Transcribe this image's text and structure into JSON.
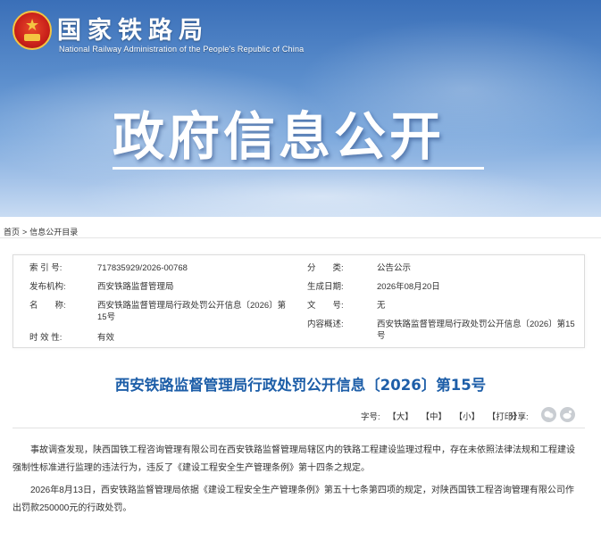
{
  "header": {
    "site_title": "国家铁路局",
    "site_subtitle": "National Railway Administration of the People's Republic of China",
    "banner_title": "政府信息公开"
  },
  "breadcrumb": {
    "home": "首页",
    "separator": ">",
    "current": "信息公开目录"
  },
  "info": {
    "index_label": "索 引 号:",
    "index_value": "717835929/2026-00768",
    "category_label": "分　　类:",
    "category_value": "公告公示",
    "publisher_label": "发布机构:",
    "publisher_value": "西安铁路监督管理局",
    "date_label": "生成日期:",
    "date_value": "2026年08月20日",
    "name_label": "名　　称:",
    "name_value": "西安铁路监督管理局行政处罚公开信息〔2026〕第15号",
    "docno_label": "文　　号:",
    "docno_value": "无",
    "summary_label": "内容概述:",
    "summary_value": "西安铁路监督管理局行政处罚公开信息〔2026〕第15号",
    "validity_label": "时 效 性:",
    "validity_value": "有效"
  },
  "article": {
    "title": "西安铁路监督管理局行政处罚公开信息〔2026〕第15号",
    "font_label": "字号:",
    "font_large": "【大】",
    "font_medium": "【中】",
    "font_small": "【小】",
    "print": "【打印】",
    "share_label": "分享:",
    "share_icons": [
      "wechat-icon",
      "weibo-icon"
    ],
    "paragraphs": [
      "事故调查发现，陕西国铁工程咨询管理有限公司在西安铁路监督管理局辖区内的铁路工程建设监理过程中，存在未依照法律法规和工程建设强制性标准进行监理的违法行为，违反了《建设工程安全生产管理条例》第十四条之规定。",
      "2026年8月13日，西安铁路监督管理局依据《建设工程安全生产管理条例》第五十七条第四项的规定，对陕西国铁工程咨询管理有限公司作出罚款250000元的行政处罚。"
    ]
  },
  "colors": {
    "title_blue": "#1d5ea8",
    "banner_blue": "#3a6fb8"
  }
}
